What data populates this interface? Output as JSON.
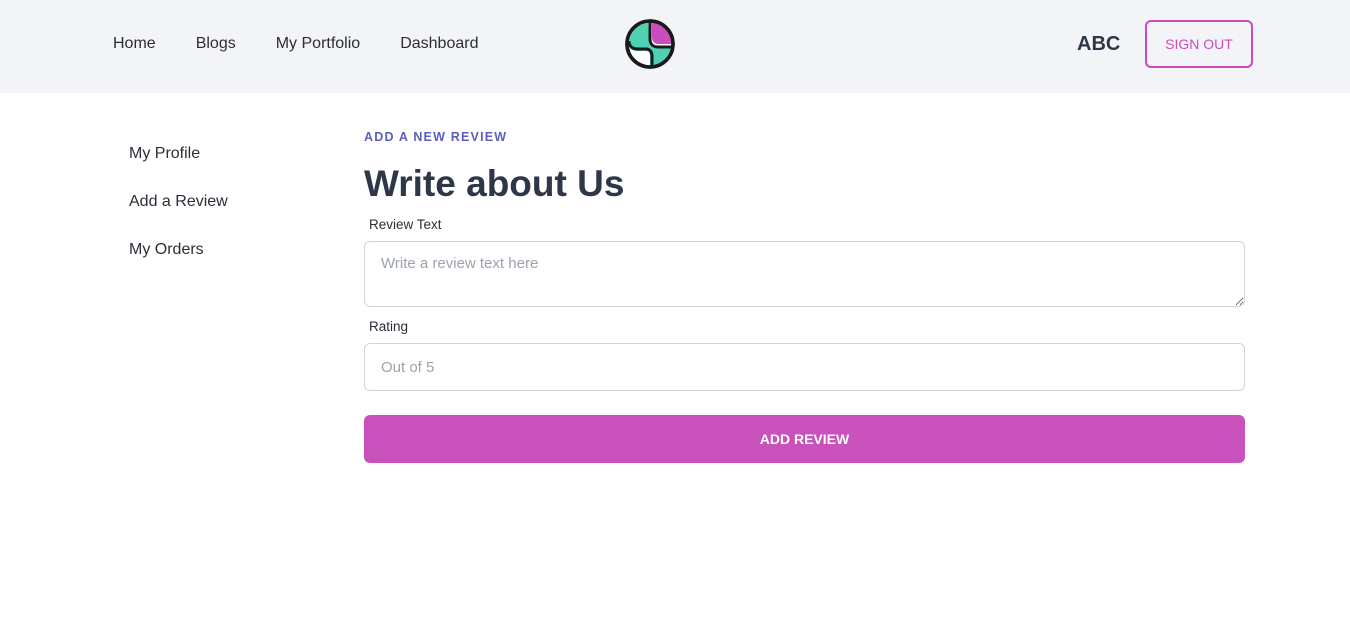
{
  "header": {
    "nav": [
      "Home",
      "Blogs",
      "My Portfolio",
      "Dashboard"
    ],
    "logo_icon": "stylized-s-logo",
    "user_name": "ABC",
    "sign_out_label": "SIGN OUT"
  },
  "sidebar": {
    "items": [
      "My Profile",
      "Add a Review",
      "My Orders"
    ]
  },
  "form": {
    "eyebrow": "ADD A NEW REVIEW",
    "title": "Write about Us",
    "review_label": "Review Text",
    "review_placeholder": "Write a review text here",
    "rating_label": "Rating",
    "rating_placeholder": "Out of 5",
    "submit_label": "ADD REVIEW"
  },
  "colors": {
    "accent": "#c94dbd",
    "eyebrow": "#5b5fbf",
    "header_bg": "#f3f4f8",
    "logo_teal": "#4fd1b5",
    "logo_magenta": "#c94dbd"
  }
}
